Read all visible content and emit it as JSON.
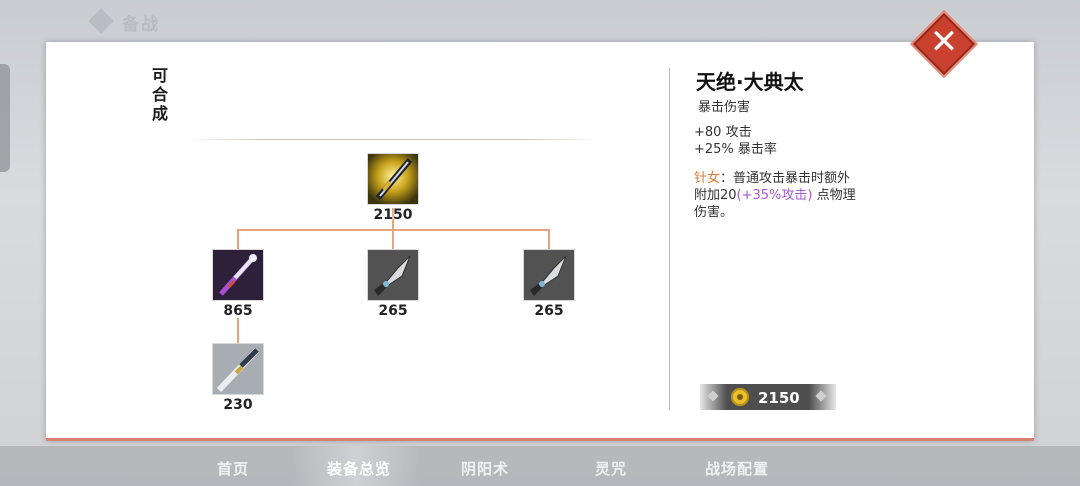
{
  "header": {
    "title": "备战"
  },
  "tabs": [
    {
      "label": "首页",
      "active": false
    },
    {
      "label": "装备总览",
      "active": true
    },
    {
      "label": "阴阳术",
      "active": false
    },
    {
      "label": "灵咒",
      "active": false
    },
    {
      "label": "战场配置",
      "active": false
    }
  ],
  "modal": {
    "composable_label": "可合成",
    "close_icon": "close-x-icon",
    "tree": {
      "root": {
        "price": "2150",
        "icon": "golden-katana-icon"
      },
      "children": [
        {
          "price": "865",
          "icon": "purple-sword-icon"
        },
        {
          "price": "265",
          "icon": "dagger-icon"
        },
        {
          "price": "265",
          "icon": "dagger-icon"
        }
      ],
      "grandchild": {
        "price": "230",
        "icon": "short-sword-icon"
      }
    },
    "detail": {
      "name": "天绝·大典太",
      "tag": "暴击伤害",
      "stats": [
        "+80 攻击",
        "+25% 暴击率"
      ],
      "passive_name": "针女",
      "passive_sep": "：",
      "passive_text_1": "普通攻击暴击时额外附加20",
      "passive_scale": "(+35%攻击)",
      "passive_text_2": " 点物理伤害。",
      "price": "2150",
      "price_icon": "coin-icon"
    },
    "colors": {
      "accent": "#e07a37",
      "scaling": "#a25bd0",
      "close": "#c9412e",
      "tree_line": "#e9a27f"
    }
  }
}
